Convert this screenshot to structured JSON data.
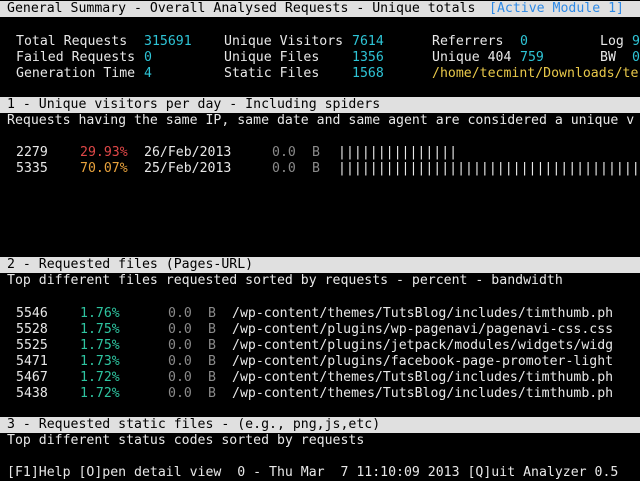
{
  "header": {
    "title": "General Summary - Overall Analysed Requests - Unique totals",
    "active_module": "[Active Module 1]"
  },
  "summary": {
    "total_requests_label": "Total Requests",
    "total_requests_value": "315691",
    "unique_visitors_label": "Unique Visitors",
    "unique_visitors_value": "7614",
    "referrers_label": "Referrers",
    "referrers_value": "0",
    "log_label": "Log",
    "log_value": "9",
    "failed_requests_label": "Failed Requests",
    "failed_requests_value": "0",
    "unique_files_label": "Unique Files",
    "unique_files_value": "1356",
    "unique404_label": "Unique 404",
    "unique404_value": "759",
    "bw_label": "BW",
    "bw_value": "0",
    "generation_time_label": "Generation Time",
    "generation_time_value": "4",
    "static_files_label": "Static Files",
    "static_files_value": "1568",
    "log_path": "/home/tecmint/Downloads/te"
  },
  "module1": {
    "title": "1 - Unique visitors per day - Including spiders",
    "subtitle": "Requests having the same IP, same date and same agent are considered a unique v",
    "rows": [
      {
        "hits": "2279",
        "percent": "29.93%",
        "date": "26/Feb/2013",
        "bw": "0.0",
        "unit": "B",
        "bar": "|||||||||||||||"
      },
      {
        "hits": "5335",
        "percent": "70.07%",
        "date": "25/Feb/2013",
        "bw": "0.0",
        "unit": "B",
        "bar": "||||||||||||||||||||||||||||||||||||||"
      }
    ]
  },
  "module2": {
    "title": "2 - Requested files (Pages-URL)",
    "subtitle": "Top different files requested sorted by requests - percent - bandwidth",
    "rows": [
      {
        "hits": "5546",
        "percent": "1.76%",
        "bw": "0.0",
        "unit": "B",
        "path": "/wp-content/themes/TutsBlog/includes/timthumb.ph"
      },
      {
        "hits": "5528",
        "percent": "1.75%",
        "bw": "0.0",
        "unit": "B",
        "path": "/wp-content/plugins/wp-pagenavi/pagenavi-css.css"
      },
      {
        "hits": "5525",
        "percent": "1.75%",
        "bw": "0.0",
        "unit": "B",
        "path": "/wp-content/plugins/jetpack/modules/widgets/widg"
      },
      {
        "hits": "5471",
        "percent": "1.73%",
        "bw": "0.0",
        "unit": "B",
        "path": "/wp-content/plugins/facebook-page-promoter-light"
      },
      {
        "hits": "5467",
        "percent": "1.72%",
        "bw": "0.0",
        "unit": "B",
        "path": "/wp-content/themes/TutsBlog/includes/timthumb.ph"
      },
      {
        "hits": "5438",
        "percent": "1.72%",
        "bw": "0.0",
        "unit": "B",
        "path": "/wp-content/themes/TutsBlog/includes/timthumb.ph"
      }
    ]
  },
  "module3": {
    "title": "3 - Requested static files - (e.g., png,js,etc)",
    "subtitle": "Top different status codes sorted by requests"
  },
  "footer": {
    "text": "[F1]Help [O]pen detail view  0 - Thu Mar  7 11:10:09 2013 [Q]uit Analyzer 0.5"
  }
}
